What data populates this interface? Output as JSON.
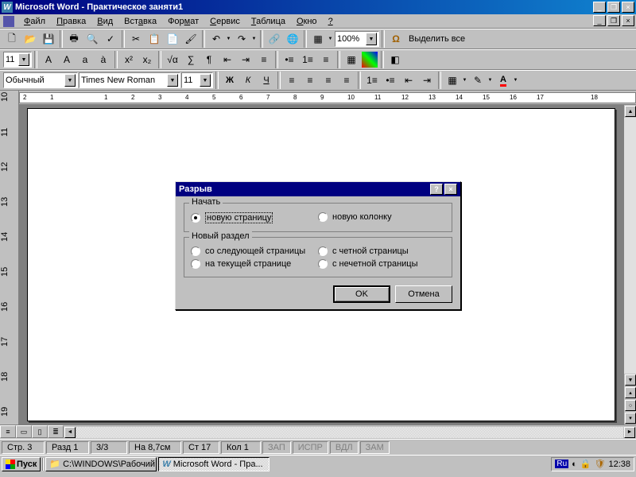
{
  "title": "Microsoft Word - Практическое заняти1",
  "menu": {
    "file": "Файл",
    "edit": "Правка",
    "view": "Вид",
    "insert": "Вставка",
    "format": "Формат",
    "tools": "Сервис",
    "table": "Таблица",
    "window": "Окно",
    "help": "?"
  },
  "toolbar": {
    "zoom": "100%",
    "select_all": "Выделить все"
  },
  "format": {
    "style": "Обычный",
    "font": "Times New Roman",
    "size": "11"
  },
  "ruler_h": [
    "2",
    "1",
    "",
    "1",
    "2",
    "3",
    "4",
    "5",
    "6",
    "7",
    "8",
    "9",
    "10",
    "11",
    "12",
    "13",
    "14",
    "15",
    "16",
    "17",
    "",
    "18"
  ],
  "ruler_v": [
    "10",
    "",
    "11",
    "",
    "12",
    "",
    "13",
    "",
    "14",
    "",
    "15",
    "",
    "16",
    "",
    "17",
    "",
    "18",
    "",
    "19"
  ],
  "status": {
    "page": "Стр. 3",
    "section": "Разд 1",
    "pages": "3/3",
    "at": "На 8,7см",
    "line": "Ст 17",
    "col": "Кол 1",
    "rec": "ЗАП",
    "trk": "ИСПР",
    "ext": "ВДЛ",
    "ovr": "ЗАМ"
  },
  "dialog": {
    "title": "Разрыв",
    "start": "Начать",
    "new_page": "новую страницу",
    "new_column": "новую колонку",
    "new_section": "Новый раздел",
    "next_page": "со следующей страницы",
    "even_page": "с четной страницы",
    "current_page": "на текущей странице",
    "odd_page": "с нечетной страницы",
    "ok": "OK",
    "cancel": "Отмена"
  },
  "taskbar": {
    "start": "Пуск",
    "explorer": "C:\\WINDOWS\\Рабочий с...",
    "word": "Microsoft Word - Пра...",
    "lang": "Ru",
    "time": "12:38"
  }
}
